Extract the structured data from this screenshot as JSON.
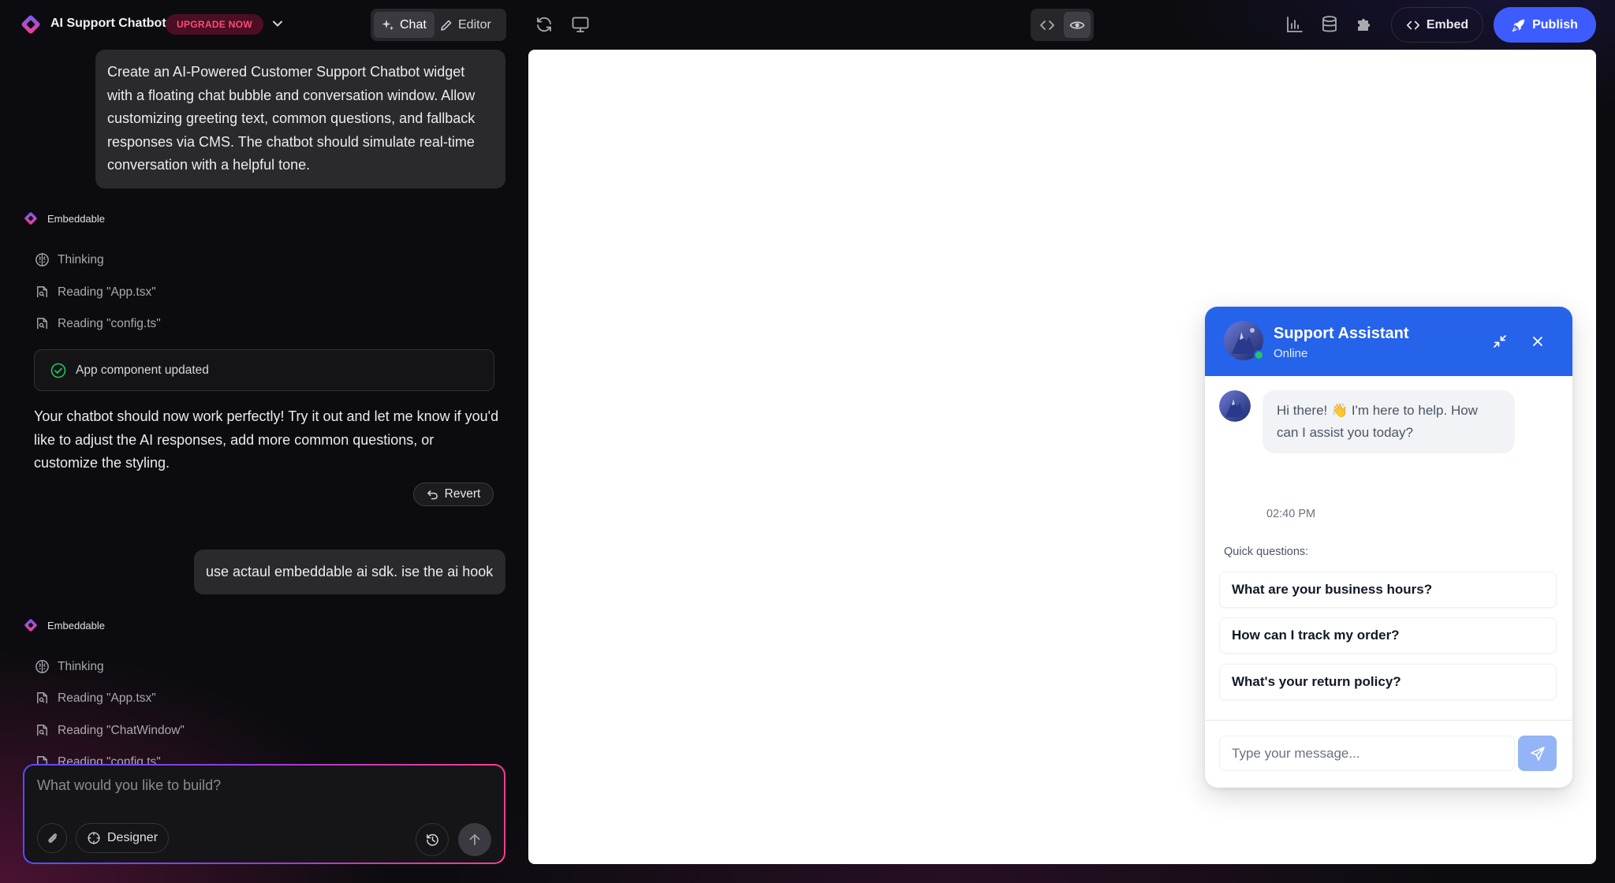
{
  "app": {
    "title": "AI Support Chatbot",
    "upgrade_label": "UPGRADE NOW"
  },
  "toolbar": {
    "modes": [
      {
        "label": "Chat",
        "icon": "sparkles-icon",
        "active": true
      },
      {
        "label": "Editor",
        "icon": "pencil-icon",
        "active": false
      }
    ],
    "embed_label": "Embed",
    "publish_label": "Publish",
    "accent": "#3d5cff"
  },
  "chat": {
    "messages": [
      {
        "role": "user",
        "text": "Create an AI-Powered Customer Support Chatbot widget with a floating chat bubble and conversation window. Allow customizing greeting text, common questions, and fallback responses via CMS. The chatbot should simulate real-time conversation with a helpful tone."
      },
      {
        "role": "agent",
        "name": "Embeddable",
        "steps": [
          "Thinking",
          "Reading \"App.tsx\"",
          "Reading \"config.ts\""
        ],
        "update_card": "App component updated",
        "text": "Your chatbot should now work perfectly! Try it out and let me know if you'd like to adjust the AI responses, add more common questions, or customize the styling.",
        "revert_label": "Revert"
      },
      {
        "role": "user",
        "text": "use actaul embeddable ai sdk. ise the ai hook"
      },
      {
        "role": "agent",
        "name": "Embeddable",
        "steps": [
          "Thinking",
          "Reading \"App.tsx\"",
          "Reading \"ChatWindow\"",
          "Reading \"config.ts\""
        ]
      }
    ],
    "input_placeholder": "What would you like to build?",
    "designer_label": "Designer"
  },
  "widget": {
    "title": "Support Assistant",
    "status": "Online",
    "greeting": "Hi there! 👋 I'm here to help. How can I assist you today?",
    "time": "02:40 PM",
    "quick_label": "Quick questions:",
    "quick_questions": [
      "What are your business hours?",
      "How can I track my order?",
      "What's your return policy?"
    ],
    "input_placeholder": "Type your message...",
    "header_color": "#2563eb",
    "online_color": "#22c55e"
  }
}
